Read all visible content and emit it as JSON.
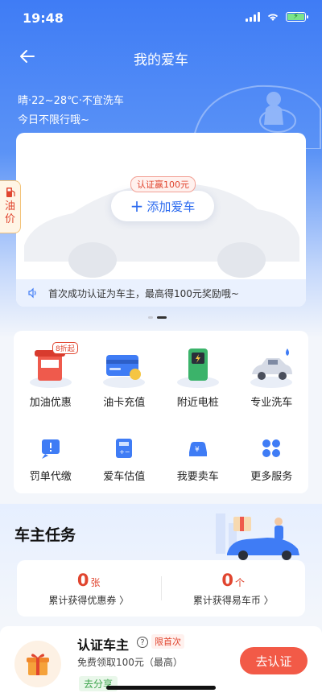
{
  "status": {
    "time": "19:48"
  },
  "nav": {
    "title": "我的爱车"
  },
  "weather": {
    "text": "晴·22~28℃·不宜洗车",
    "limit": "今日不限行哦~"
  },
  "car_card": {
    "cert_badge": "认证赢100元",
    "add_label": "添加爱车",
    "notice": "首次成功认证为车主，最高得100元奖励哦~"
  },
  "oil_tab": {
    "line1": "油",
    "line2": "价"
  },
  "services": {
    "row1": [
      {
        "label": "加油优惠",
        "icon": "gas-station-icon",
        "tag": "8折起"
      },
      {
        "label": "油卡充值",
        "icon": "fuel-card-icon"
      },
      {
        "label": "附近电桩",
        "icon": "charging-pile-icon"
      },
      {
        "label": "专业洗车",
        "icon": "car-wash-icon"
      }
    ],
    "row2": [
      {
        "label": "罚单代缴",
        "icon": "ticket-icon"
      },
      {
        "label": "爱车估值",
        "icon": "calculator-icon"
      },
      {
        "label": "我要卖车",
        "icon": "sell-car-icon"
      },
      {
        "label": "更多服务",
        "icon": "more-icon"
      }
    ]
  },
  "task_section": {
    "title": "车主任务",
    "stats": [
      {
        "num": "0",
        "unit": "张",
        "desc": "累计获得优惠券 〉"
      },
      {
        "num": "0",
        "unit": "个",
        "desc": "累计获得易车币 〉"
      }
    ],
    "item": {
      "name": "认证车主",
      "badge": "限首次",
      "desc": "免费领取100元（最高）",
      "share": "去分享",
      "button": "去认证"
    }
  },
  "colors": {
    "primary": "#3f7cf5",
    "accent_red": "#e0452f",
    "button_red": "#f25a47"
  }
}
